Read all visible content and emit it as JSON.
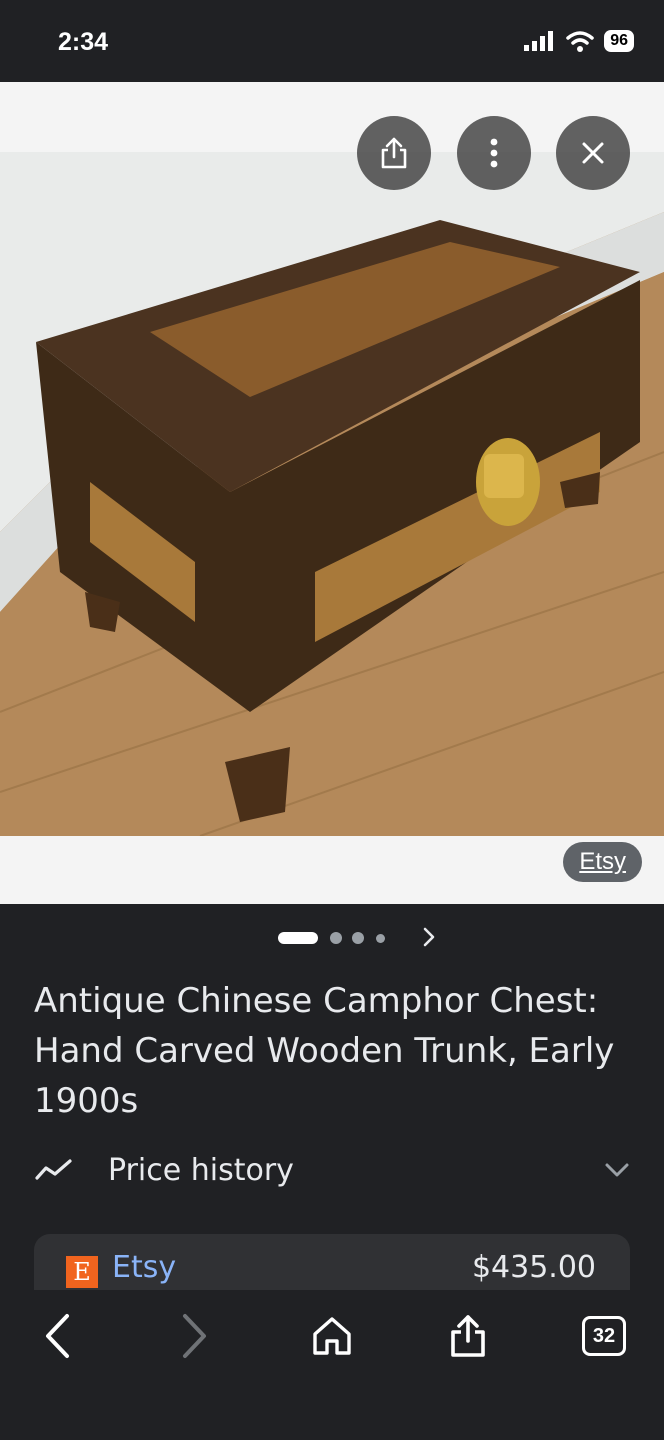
{
  "status_bar": {
    "time": "2:34",
    "battery": "96"
  },
  "image_viewer": {
    "buttons": {
      "share": "share-icon",
      "more": "more-vert-icon",
      "close": "close-icon"
    },
    "source_chip": "Etsy"
  },
  "carousel": {
    "count": 4,
    "active_index": 0
  },
  "product": {
    "title": "Antique Chinese Camphor Chest: Hand Carved Wooden Trunk, Early 1900s"
  },
  "price_history": {
    "label": "Price history"
  },
  "merchant": {
    "logo_letter": "E",
    "name": "Etsy",
    "price": "$435.00"
  },
  "bottom_nav": {
    "tabs_count": "32"
  },
  "colors": {
    "background": "#202124",
    "link": "#8ab4f8",
    "etsy_orange": "#f1641e"
  }
}
